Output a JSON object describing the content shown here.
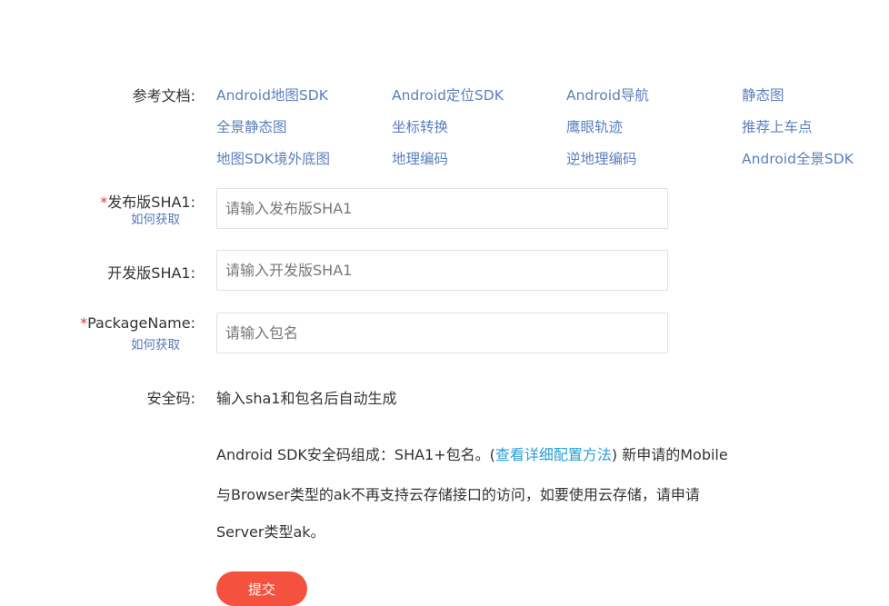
{
  "docs": {
    "label": "参考文档:",
    "links": [
      [
        "Android地图SDK",
        "Android定位SDK",
        "Android导航",
        "静态图"
      ],
      [
        "全景静态图",
        "坐标转换",
        "鹰眼轨迹",
        "推荐上车点"
      ],
      [
        "地图SDK境外底图",
        "地理编码",
        "逆地理编码",
        "Android全景SDK"
      ]
    ]
  },
  "release_sha1": {
    "required_mark": "*",
    "label": "发布版SHA1:",
    "help_link": "如何获取",
    "placeholder": "请输入发布版SHA1"
  },
  "dev_sha1": {
    "label": "开发版SHA1:",
    "placeholder": "请输入开发版SHA1"
  },
  "package_name": {
    "required_mark": "*",
    "label": "PackageName:",
    "help_link": "如何获取",
    "placeholder": "请输入包名"
  },
  "security_code": {
    "label": "安全码:",
    "value": "输入sha1和包名后自动生成"
  },
  "note": {
    "line1_before": "Android SDK安全码组成：SHA1+包名。(",
    "line1_link": "查看详细配置方法",
    "line1_after": ") 新申请的Mobile",
    "line2": "与Browser类型的ak不再支持云存储接口的访问，如要使用云存储，请申请",
    "line3": "Server类型ak。"
  },
  "submit_label": "提交",
  "colors": {
    "link": "#5b7fbd",
    "required": "#e4393c",
    "submit_bg": "#f4523e",
    "inline_link": "#2a9fd8"
  }
}
